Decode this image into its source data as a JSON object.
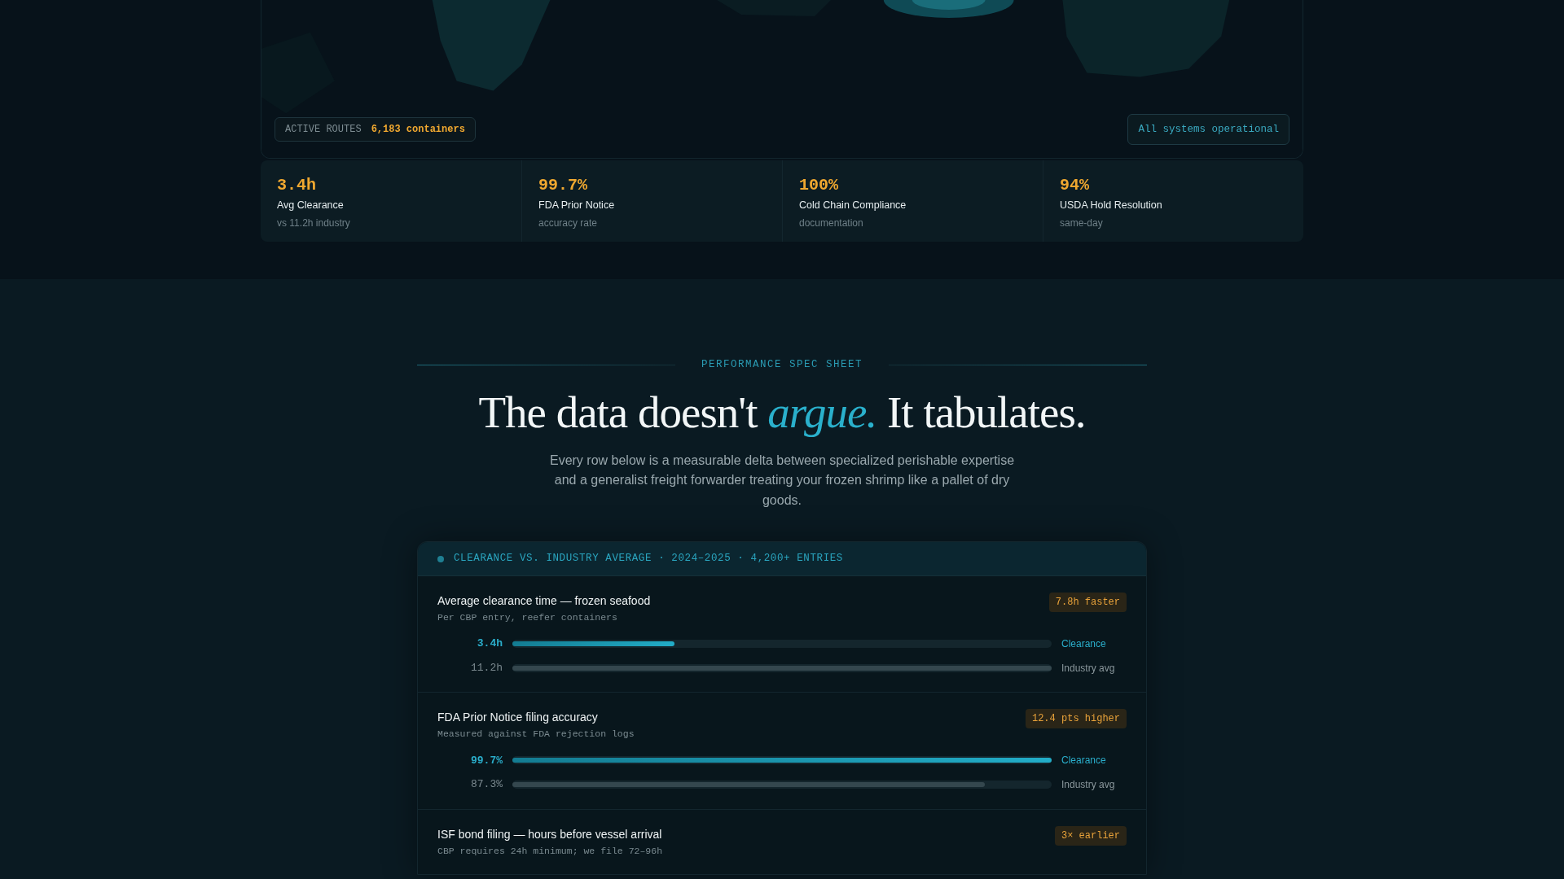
{
  "hero": {
    "active_routes": {
      "label": "ACTIVE ROUTES",
      "value": "6,183 containers"
    },
    "status": "All systems operational",
    "stats": [
      {
        "value": "3.4h",
        "label": "Avg Clearance",
        "note": "vs 11.2h industry"
      },
      {
        "value": "99.7%",
        "label": "FDA Prior Notice",
        "note": "accuracy rate"
      },
      {
        "value": "100%",
        "label": "Cold Chain Compliance",
        "note": "documentation"
      },
      {
        "value": "94%",
        "label": "USDA Hold Resolution",
        "note": "same-day"
      }
    ]
  },
  "spec": {
    "eyebrow": "PERFORMANCE SPEC SHEET",
    "headline_start": "The data doesn't",
    "headline_accent": "argue.",
    "headline_end": "It tabulates.",
    "intro": "Every row below is a measurable delta between specialized perishable expertise and a generalist freight forwarder treating your frozen shrimp like a pallet of dry goods.",
    "table": {
      "title": "CLEARANCE VS. INDUSTRY AVERAGE · 2024–2025 · 4,200+ ENTRIES",
      "rows": [
        {
          "title": "Average clearance time — frozen seafood",
          "subtitle": "Per CBP entry, reefer containers",
          "badge": "7.8h faster",
          "bars": [
            {
              "kind": "ours",
              "reading": "3.4h",
              "level": 0.3,
              "label": "Clearance"
            },
            {
              "kind": "industry",
              "reading": "11.2h",
              "level": 1.0,
              "label": "Industry avg"
            }
          ]
        },
        {
          "title": "FDA Prior Notice filing accuracy",
          "subtitle": "Measured against FDA rejection logs",
          "badge": "12.4 pts higher",
          "bars": [
            {
              "kind": "ours",
              "reading": "99.7%",
              "level": 1.0,
              "label": "Clearance"
            },
            {
              "kind": "industry",
              "reading": "87.3%",
              "level": 0.876,
              "label": "Industry avg"
            }
          ]
        },
        {
          "title": "ISF bond filing — hours before vessel arrival",
          "subtitle": "CBP requires 24h minimum; we file 72–96h",
          "badge": "3× earlier"
        }
      ]
    }
  }
}
